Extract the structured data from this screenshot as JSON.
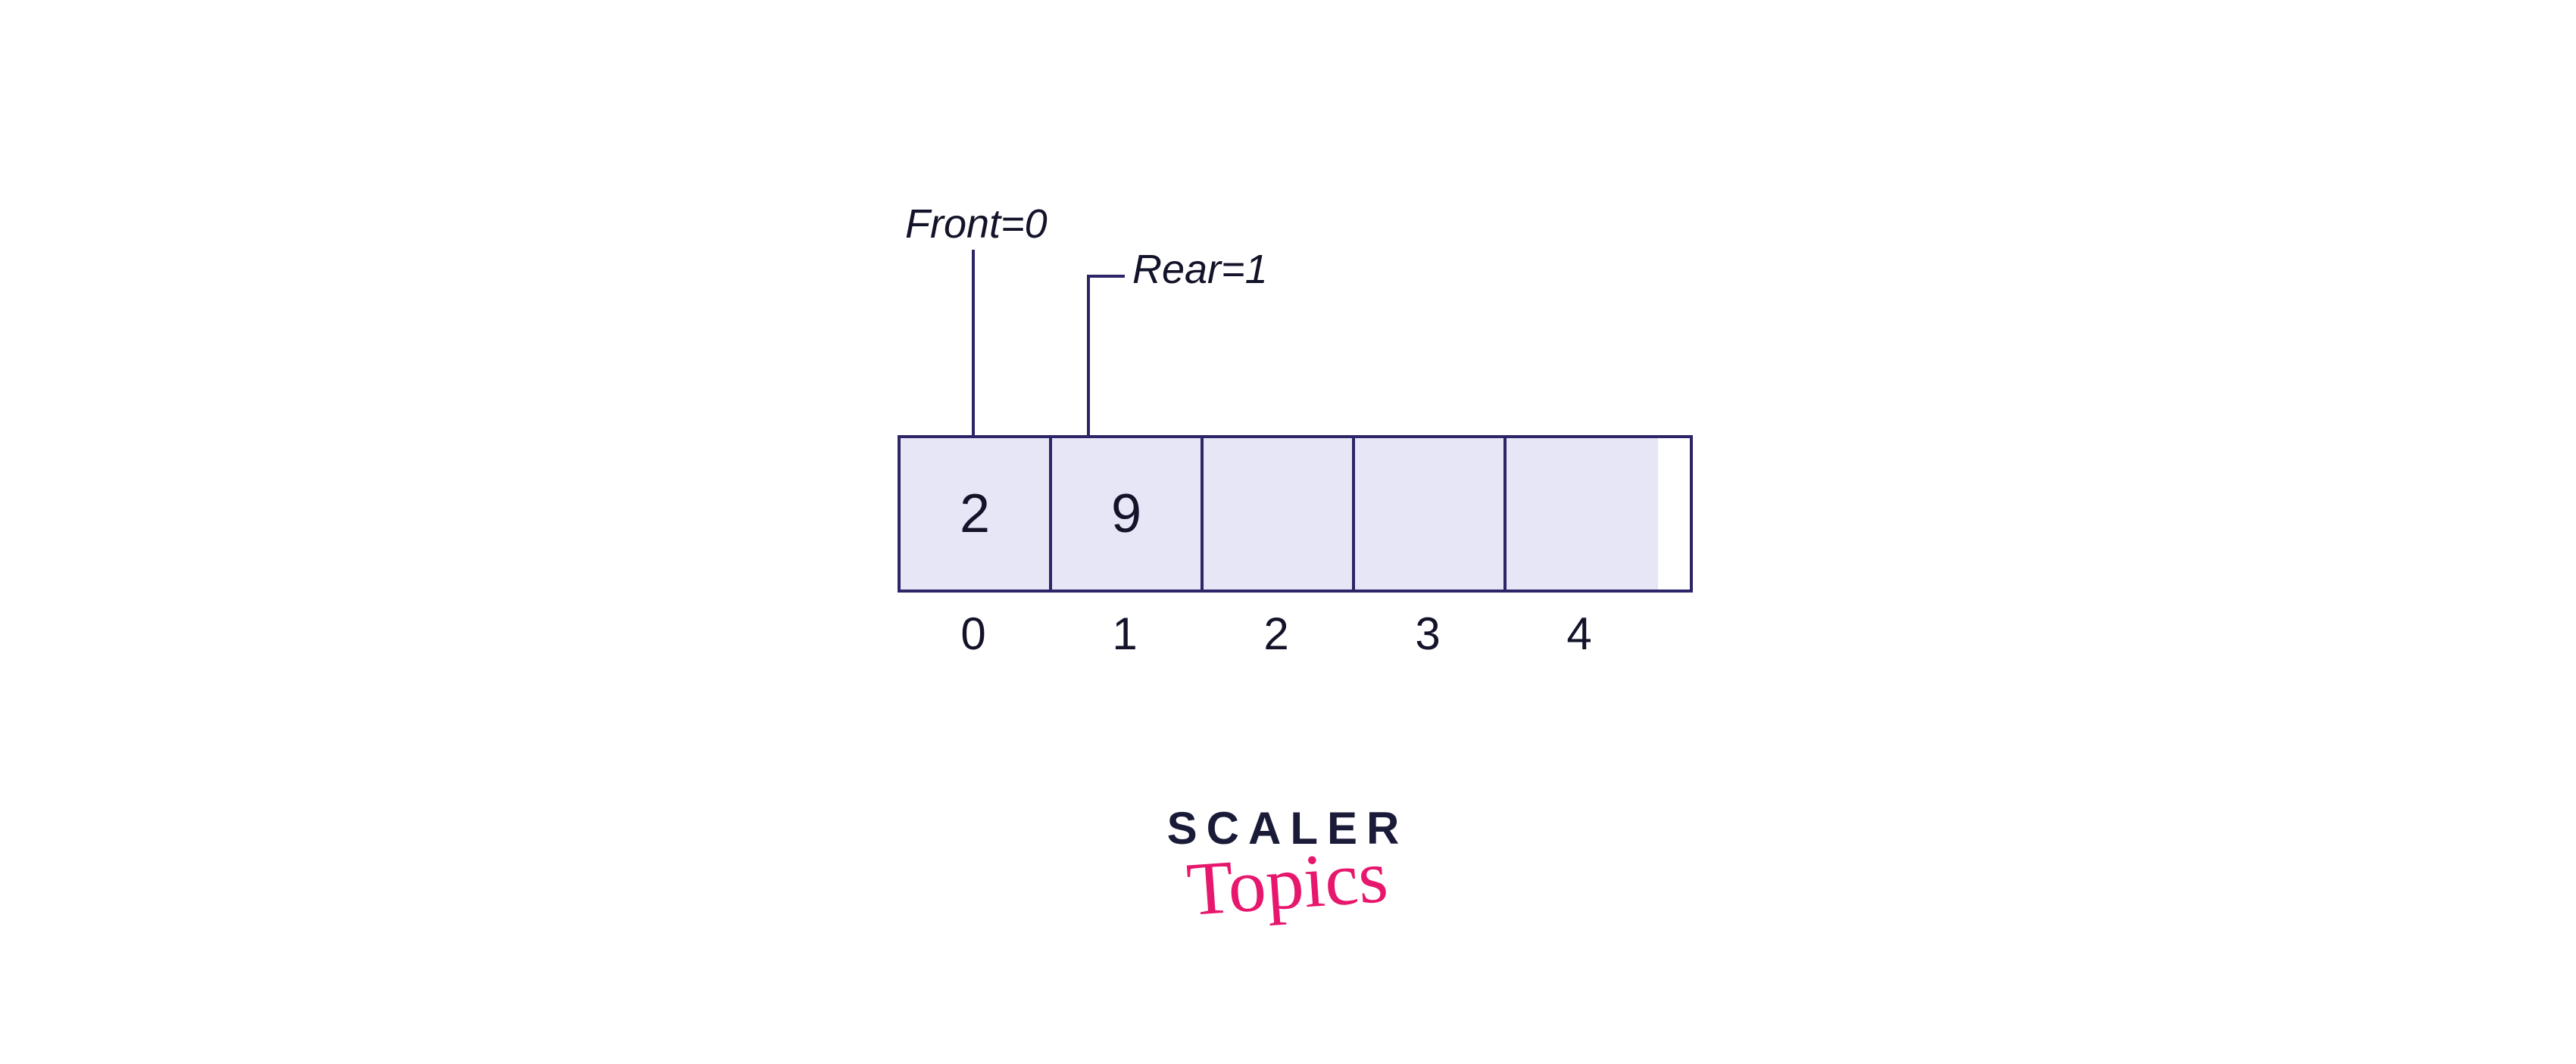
{
  "pointers": {
    "front_label": "Front=0",
    "rear_label": "Rear=1"
  },
  "queue": {
    "cells": [
      "2",
      "9",
      "",
      "",
      ""
    ],
    "indices": [
      "0",
      "1",
      "2",
      "3",
      "4"
    ]
  },
  "brand": {
    "line1": "SCALER",
    "line2": "Topics"
  },
  "colors": {
    "cell_fill": "#e7e6f7",
    "border": "#2c2567",
    "text": "#13132a",
    "accent": "#e6176c"
  }
}
